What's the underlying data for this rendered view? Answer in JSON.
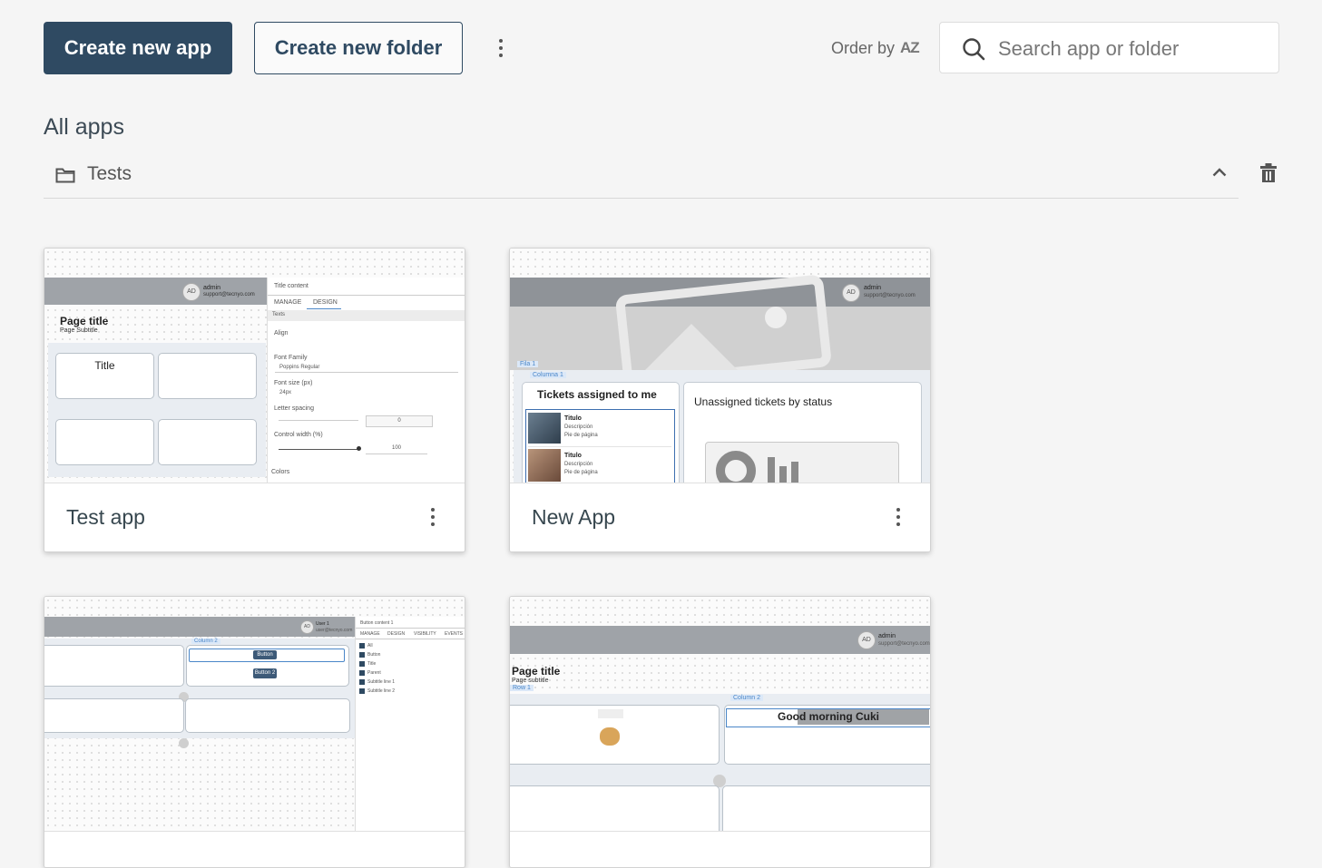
{
  "toolbar": {
    "create_app_label": "Create new app",
    "create_folder_label": "Create new folder",
    "more_icon": "more-vertical-icon",
    "order_label": "Order by",
    "order_icon_text": "AZ",
    "search_placeholder": "Search app or folder"
  },
  "section": {
    "title": "All apps"
  },
  "folder": {
    "name": "Tests",
    "collapse_icon": "chevron-up-icon",
    "delete_icon": "trash-icon"
  },
  "apps": [
    {
      "name": "Test app",
      "preview": {
        "avatar": "AD",
        "user": "admin",
        "email": "support@tecnyo.com",
        "page_title": "Page title",
        "page_subtitle": "Page Subtitle",
        "box_title": "Title",
        "panel_title": "Title content",
        "tabs": [
          "MANAGE",
          "DESIGN"
        ],
        "panel_section": "Texts",
        "align": "Align",
        "font_family": "Font Family",
        "font_family_value": "Poppins Regular",
        "font_size": "Font size (px)",
        "font_size_value": "24px",
        "letter_spacing": "Letter spacing",
        "letter_spacing_value": "0",
        "control_width": "Control width (%)",
        "control_width_value": "100",
        "colors": "Colors"
      }
    },
    {
      "name": "New App",
      "preview": {
        "avatar": "AD",
        "user": "admin",
        "email": "support@tecnyo.com",
        "row_tag": "Fila 1",
        "col_tag": "Columna 1",
        "tickets_title": "Tickets assigned to me",
        "items": [
          {
            "title": "Titulo",
            "desc": "Descripción",
            "foot": "Pie de página"
          },
          {
            "title": "Titulo",
            "desc": "Descripción",
            "foot": "Pie de página"
          }
        ],
        "unassigned_title": "Unassigned tickets by status"
      }
    },
    {
      "name": "",
      "preview": {
        "avatar": "AD",
        "user": "User 1",
        "email": "user@tecnyo.com",
        "col_tag": "Column 2",
        "button1": "Button",
        "button2": "Button 2",
        "panel_title": "Button content 1",
        "tabs": [
          "MANAGE",
          "DESIGN",
          "VISIBILITY",
          "EVENTS"
        ],
        "checks": [
          "All",
          "Button",
          "Title",
          "Parent",
          "Subtitle line 1",
          "Subtitle line 2"
        ]
      }
    },
    {
      "name": "",
      "preview": {
        "avatar": "AD",
        "user": "admin",
        "email": "support@tecnyo.com",
        "page_title": "Page title",
        "page_subtitle": "Page subtitle",
        "row_tag": "Row 1",
        "col_tag": "Column 2",
        "greeting": "Good morning Cuki"
      }
    }
  ]
}
